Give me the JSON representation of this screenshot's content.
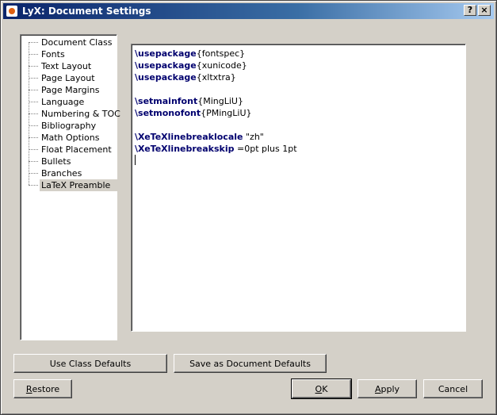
{
  "window": {
    "title": "LyX: Document Settings",
    "help_label": "?",
    "close_label": "×"
  },
  "sidebar": {
    "items": [
      {
        "label": "Document Class"
      },
      {
        "label": "Fonts"
      },
      {
        "label": "Text Layout"
      },
      {
        "label": "Page Layout"
      },
      {
        "label": "Page Margins"
      },
      {
        "label": "Language"
      },
      {
        "label": "Numbering & TOC"
      },
      {
        "label": "Bibliography"
      },
      {
        "label": "Math Options"
      },
      {
        "label": "Float Placement"
      },
      {
        "label": "Bullets"
      },
      {
        "label": "Branches"
      },
      {
        "label": "LaTeX Preamble",
        "selected": true
      }
    ]
  },
  "preamble": {
    "lines": [
      {
        "cmd": "\\usepackage",
        "arg": "{fontspec}"
      },
      {
        "cmd": "\\usepackage",
        "arg": "{xunicode}"
      },
      {
        "cmd": "\\usepackage",
        "arg": "{xltxtra}"
      },
      {
        "cmd": "",
        "arg": ""
      },
      {
        "cmd": "\\setmainfont",
        "arg": "{MingLiU}"
      },
      {
        "cmd": "\\setmonofont",
        "arg": "{PMingLiU}"
      },
      {
        "cmd": "",
        "arg": ""
      },
      {
        "cmd": "\\XeTeXlinebreaklocale",
        "arg": " \"zh\""
      },
      {
        "cmd": "\\XeTeXlinebreakskip",
        "arg": " =0pt plus 1pt"
      }
    ]
  },
  "buttons": {
    "use_class_defaults": "Use Class Defaults",
    "save_as_document_defaults": "Save as Document Defaults",
    "restore_u": "R",
    "restore_rest": "estore",
    "ok_u": "O",
    "ok_rest": "K",
    "apply_u": "A",
    "apply_rest": "pply",
    "cancel": "Cancel"
  }
}
